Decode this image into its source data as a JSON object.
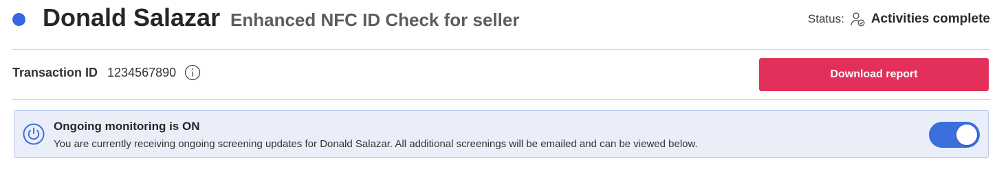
{
  "header": {
    "name": "Donald Salazar",
    "check_type": "Enhanced NFC ID Check for seller",
    "status_label": "Status:",
    "status_icon": "user-check-icon",
    "status_value": "Activities complete",
    "dot_color": "#3568e0"
  },
  "transaction": {
    "label": "Transaction ID",
    "value": "1234567890",
    "info_icon": "info-icon"
  },
  "actions": {
    "download_label": "Download report",
    "download_color": "#e2305a"
  },
  "monitoring": {
    "icon": "power-icon",
    "title": "Ongoing monitoring is ON",
    "description": "You are currently receiving ongoing screening updates for Donald Salazar. All additional screenings will be emailed and can be viewed below.",
    "toggle_on": true,
    "toggle_color": "#3a6fdc",
    "accent_color": "#3a6fdc"
  }
}
